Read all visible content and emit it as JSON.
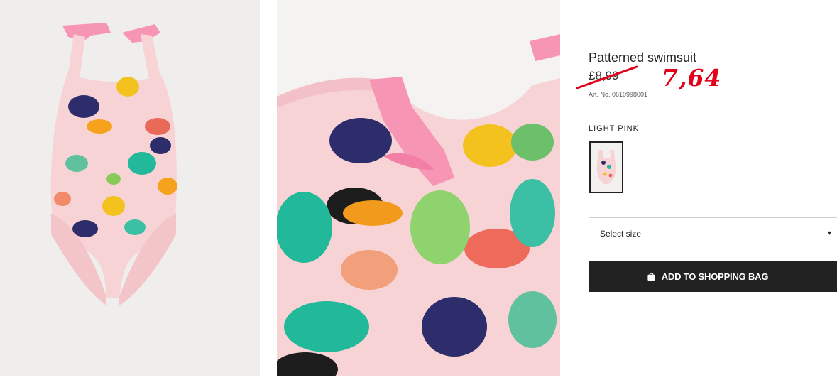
{
  "product": {
    "title": "Patterned swimsuit",
    "old_price": "£8,99",
    "sale_price": "7,64",
    "article_number": "Art. No. 0610998001",
    "color_name": "LIGHT PINK"
  },
  "size_select": {
    "label": "Select size",
    "chevron": "▾"
  },
  "add_button": {
    "label": "ADD TO SHOPPING BAG",
    "icon": "shopping-bag-icon"
  },
  "colors": {
    "swimsuit_pink": "#f8d3d6",
    "bow_pink": "#f796b4",
    "button_bg": "#222222",
    "sale_red": "#e3001b"
  },
  "images": {
    "left": "product-full-view",
    "right": "product-detail-closeup"
  }
}
